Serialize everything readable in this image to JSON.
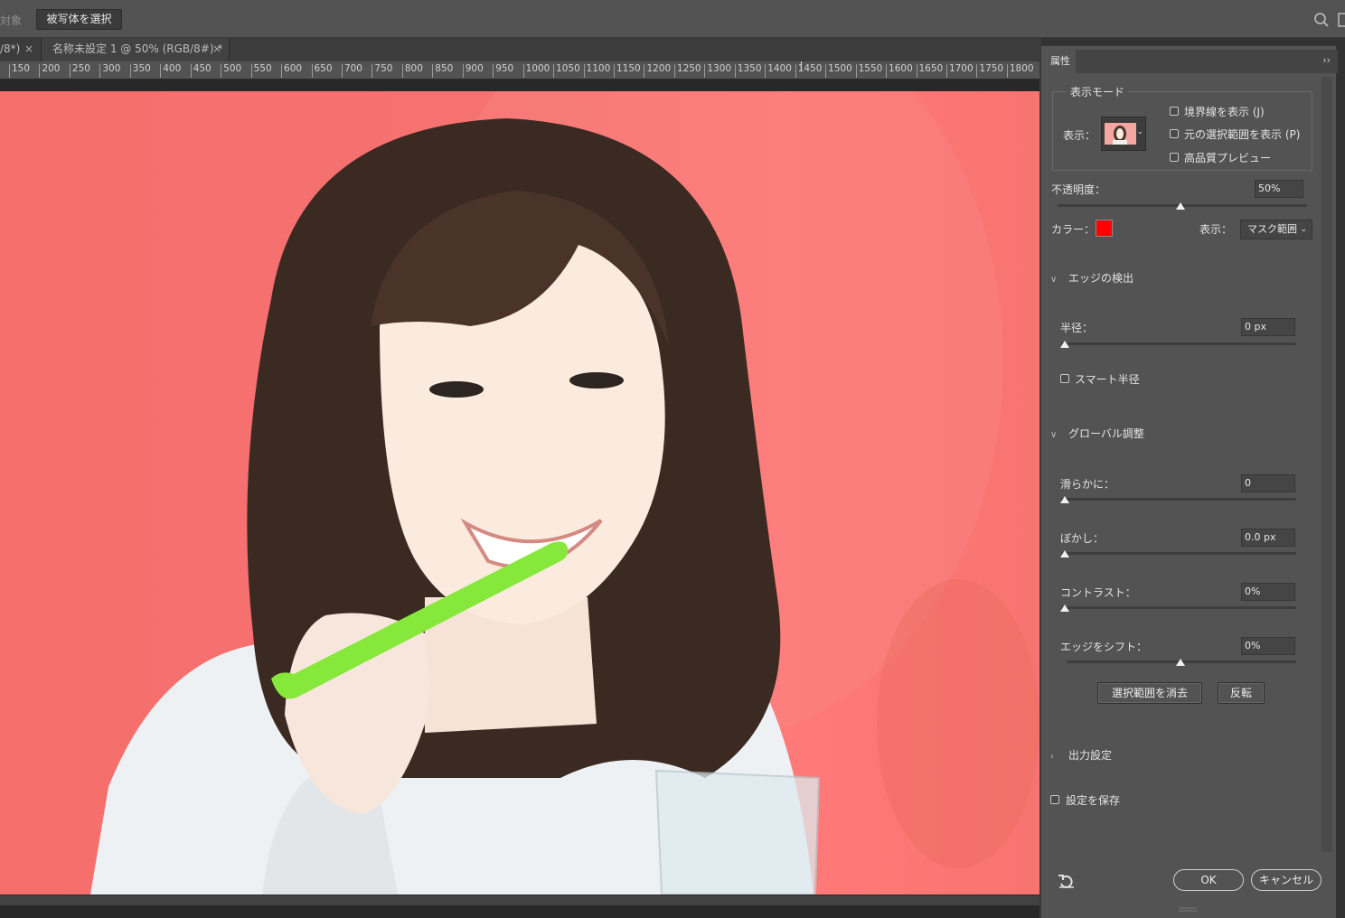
{
  "optionsbar": {
    "object_label": "対象",
    "select_subject_button": "被写体を選択"
  },
  "tabs": [
    {
      "label": "/8*)",
      "close": "×"
    },
    {
      "label": "名称未設定 1 @ 50% (RGB/8#) *",
      "close": "×"
    }
  ],
  "ruler": {
    "ticks": [
      "150",
      "200",
      "250",
      "300",
      "350",
      "400",
      "450",
      "500",
      "550",
      "600",
      "650",
      "700",
      "750",
      "800",
      "850",
      "900",
      "950",
      "1000",
      "1050",
      "1100",
      "1150",
      "1200",
      "1250",
      "1300",
      "1350",
      "1400",
      "1450",
      "1500",
      "1550",
      "1600",
      "1650",
      "1700",
      "1750",
      "1800"
    ]
  },
  "panel": {
    "tab_label": "属性",
    "collapse": "››",
    "view_mode": {
      "legend": "表示モード",
      "view_label": "表示：",
      "show_edge": "境界線を表示 (J)",
      "show_original": "元の選択範囲を表示 (P)",
      "high_quality": "高品質プレビュー"
    },
    "opacity": {
      "label": "不透明度：",
      "value": "50%",
      "level": 0.5
    },
    "color": {
      "label": "カラー：",
      "swatch": "#ff0000"
    },
    "display": {
      "label": "表示：",
      "value": "マスク範囲"
    },
    "edge_detection": {
      "title": "エッジの検出",
      "radius_label": "半径：",
      "radius_value": "0 px",
      "smart_radius": "スマート半径"
    },
    "global": {
      "title": "グローバル調整",
      "smooth_label": "滑らかに：",
      "smooth_value": "0",
      "feather_label": "ぼかし：",
      "feather_value": "0.0 px",
      "contrast_label": "コントラスト：",
      "contrast_value": "0%",
      "shift_label": "エッジをシフト：",
      "shift_value": "0%"
    },
    "clear_selection_button": "選択範囲を消去",
    "invert_button": "反転",
    "output": {
      "title": "出力設定"
    },
    "remember_settings": "設定を保存",
    "ok_button": "OK",
    "cancel_button": "キャンセル"
  }
}
